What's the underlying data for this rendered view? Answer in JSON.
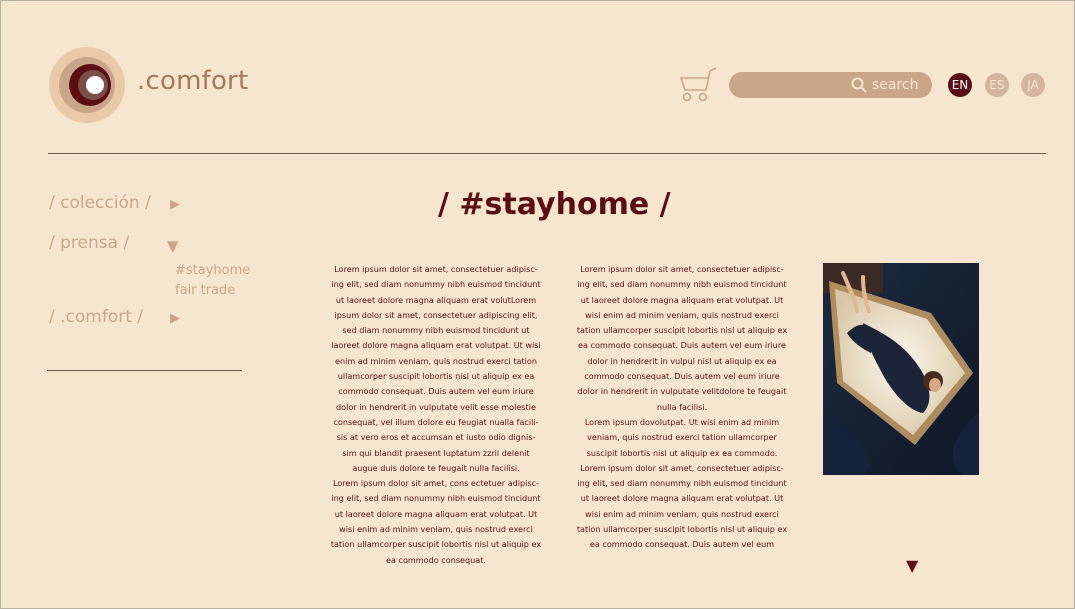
{
  "header": {
    "brand": ".comfort",
    "search_label": "search",
    "languages": [
      "EN",
      "ES",
      "JA"
    ],
    "active_language": "EN"
  },
  "nav": {
    "items": [
      {
        "label": "/ colección /"
      },
      {
        "label": "/ prensa /"
      },
      {
        "label": "/ .comfort /"
      }
    ],
    "submenu": [
      "#stayhome",
      "fair trade"
    ]
  },
  "article": {
    "title": "/ #stayhome /",
    "col1": [
      "Lorem ipsum dolor sit amet, consectetuer adipisc-ing elit, sed diam nonummy nibh euismod tincidunt ut laoreet dolore magna aliquam erat volutLorem ipsum dolor sit amet, consectetuer adipiscing elit, sed diam nonummy nibh euismod tincidunt ut laoreet dolore magna aliquam erat volutpat. Ut wisi enim ad minim veniam, quis nostrud exerci tation ullamcorper suscipit lobortis nisl ut aliquip ex ea commodo consequat. Duis autem vel eum iriure dolor in hendrerit in vulputate velit esse molestie consequat, vel illum dolore eu feugiat nualla facili-sis at vero eros et accumsan et iusto odio dignis-sim qui blandit praesent luptatum zzril delenit augue duis dolore te feugait nulla facilisi.",
      "Lorem ipsum dolor sit amet, cons ectetuer adipisc-ing elit, sed diam nonummy nibh euismod tincidunt ut laoreet dolore magna aliquam erat volutpat. Ut wisi enim ad minim veniam, quis nostrud exerci tation ullamcorper suscipit lobortis nisl ut aliquip ex ea commodo consequat."
    ],
    "col2": [
      "Lorem ipsum dolor sit amet, consectetuer adipisc-ing elit, sed diam nonummy nibh euismod tincidunt ut laoreet dolore magna aliquam erat volutpat. Ut wisi enim ad minim veniam, quis nostrud exerci tation ullamcorper suscipit lobortis nisl ut aliquip ex ea commodo consequat. Duis autem vel eum iriure dolor in hendrerit in vulpul nisl ut aliquip ex ea commodo consequat. Duis autem vel eum iriure dolor in hendrerit in vulputate velitdolore te feugait nulla facilisi.",
      "Lorem ipsum dovolutpat. Ut wisi enim ad minim veniam, quis nostrud exerci tation ullamcorper suscipit lobortis nisl ut aliquip ex ea commodo. Lorem ipsum dolor sit amet, consectetuer adipisc-ing elit, sed diam nonummy nibh euismod tincidunt ut laoreet dolore magna aliquam erat volutpat. Ut wisi enim ad minim veniam, quis nostrud exerci tation ullamcorper suscipit lobortis nisl ut aliquip ex ea commodo consequat. Duis autem vel eum"
    ]
  },
  "colors": {
    "background": "#f6e6cf",
    "accent_dark": "#5a0e14",
    "accent_light": "#c9a68a"
  }
}
